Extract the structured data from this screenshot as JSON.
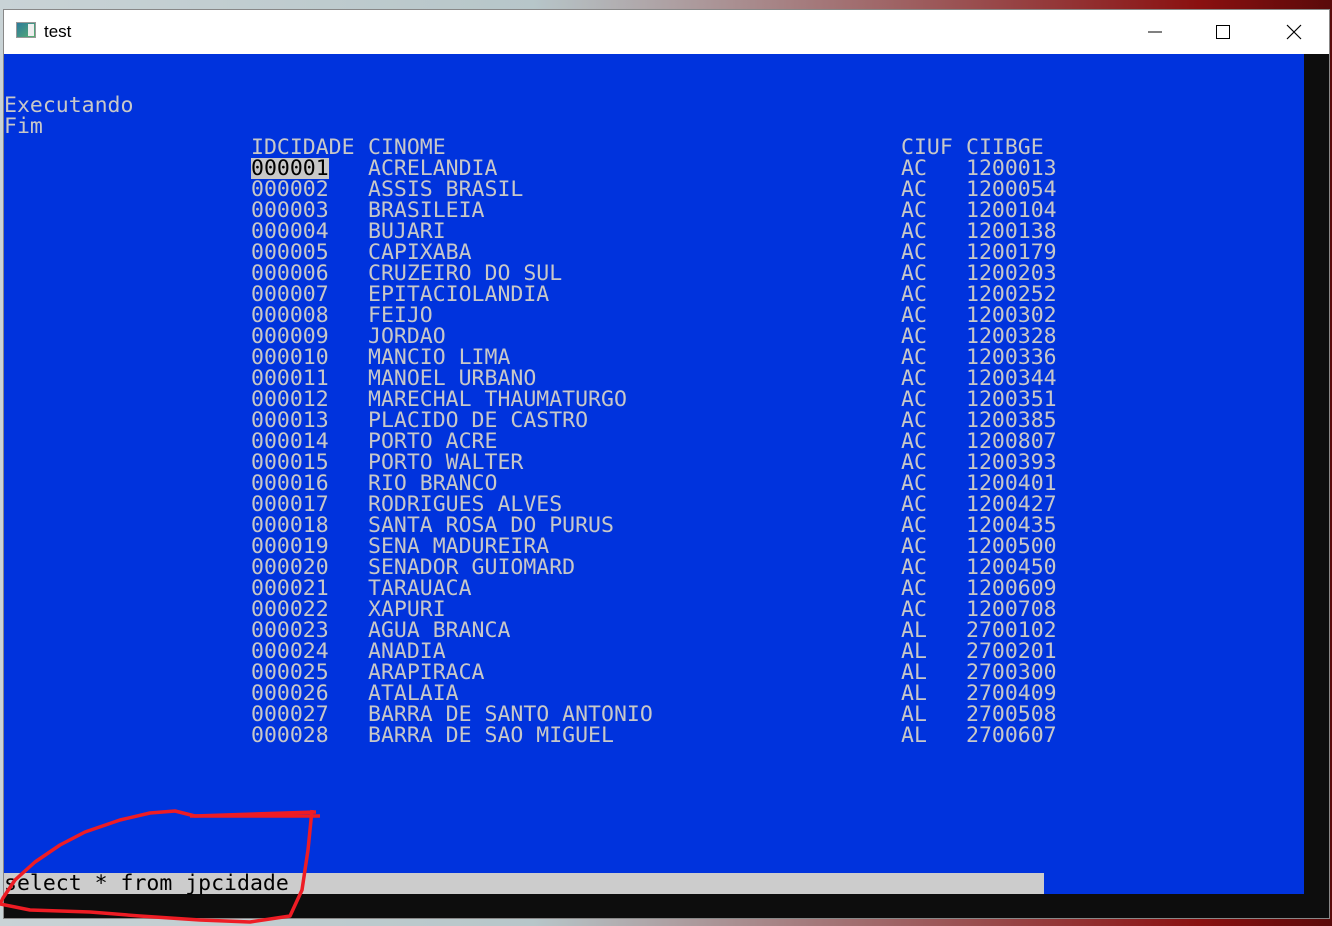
{
  "window": {
    "title": "test",
    "controls": [
      "minimize",
      "maximize",
      "close"
    ]
  },
  "console": {
    "lines": [
      "Executando",
      "Fim"
    ],
    "columns": [
      "IDCIDADE",
      "CINOME",
      "CIUF",
      "CIIBGE"
    ],
    "rows": [
      [
        "000001",
        "ACRELANDIA",
        "AC",
        "1200013"
      ],
      [
        "000002",
        "ASSIS BRASIL",
        "AC",
        "1200054"
      ],
      [
        "000003",
        "BRASILEIA",
        "AC",
        "1200104"
      ],
      [
        "000004",
        "BUJARI",
        "AC",
        "1200138"
      ],
      [
        "000005",
        "CAPIXABA",
        "AC",
        "1200179"
      ],
      [
        "000006",
        "CRUZEIRO DO SUL",
        "AC",
        "1200203"
      ],
      [
        "000007",
        "EPITACIOLANDIA",
        "AC",
        "1200252"
      ],
      [
        "000008",
        "FEIJO",
        "AC",
        "1200302"
      ],
      [
        "000009",
        "JORDAO",
        "AC",
        "1200328"
      ],
      [
        "000010",
        "MANCIO LIMA",
        "AC",
        "1200336"
      ],
      [
        "000011",
        "MANOEL URBANO",
        "AC",
        "1200344"
      ],
      [
        "000012",
        "MARECHAL THAUMATURGO",
        "AC",
        "1200351"
      ],
      [
        "000013",
        "PLACIDO DE CASTRO",
        "AC",
        "1200385"
      ],
      [
        "000014",
        "PORTO ACRE",
        "AC",
        "1200807"
      ],
      [
        "000015",
        "PORTO WALTER",
        "AC",
        "1200393"
      ],
      [
        "000016",
        "RIO BRANCO",
        "AC",
        "1200401"
      ],
      [
        "000017",
        "RODRIGUES ALVES",
        "AC",
        "1200427"
      ],
      [
        "000018",
        "SANTA ROSA DO PURUS",
        "AC",
        "1200435"
      ],
      [
        "000019",
        "SENA MADUREIRA",
        "AC",
        "1200500"
      ],
      [
        "000020",
        "SENADOR GUIOMARD",
        "AC",
        "1200450"
      ],
      [
        "000021",
        "TARAUACA",
        "AC",
        "1200609"
      ],
      [
        "000022",
        "XAPURI",
        "AC",
        "1200708"
      ],
      [
        "000023",
        "AGUA BRANCA",
        "AL",
        "2700102"
      ],
      [
        "000024",
        "ANADIA",
        "AL",
        "2700201"
      ],
      [
        "000025",
        "ARAPIRACA",
        "AL",
        "2700300"
      ],
      [
        "000026",
        "ATALAIA",
        "AL",
        "2700409"
      ],
      [
        "000027",
        "BARRA DE SANTO ANTONIO",
        "AL",
        "2700508"
      ],
      [
        "000028",
        "BARRA DE SAO MIGUEL",
        "AL",
        "2700607"
      ]
    ],
    "command": "select * from jpcidade"
  },
  "colors": {
    "console_bg": "#0033dd",
    "console_fg": "#c8c8c8",
    "input_bg": "#cccccc",
    "annotation": "#ee1c24"
  }
}
